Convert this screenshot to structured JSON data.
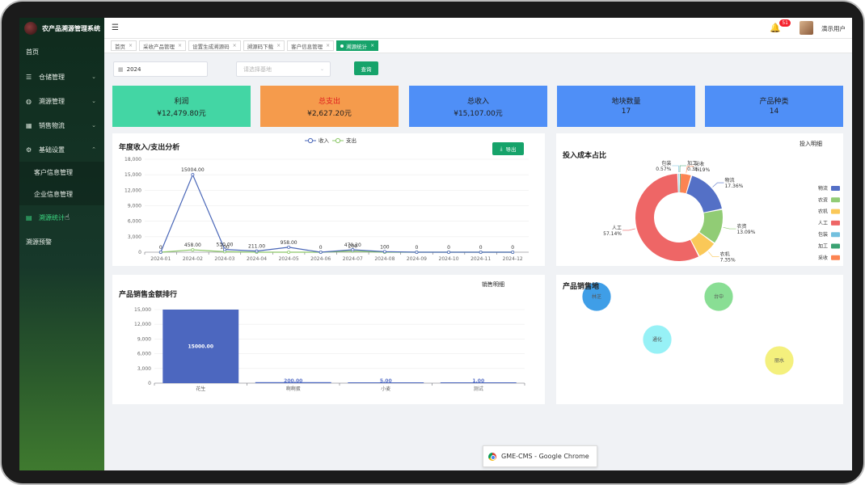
{
  "app": {
    "title": "农产品溯源管理系统"
  },
  "sidebar": {
    "items": [
      {
        "label": "首页"
      },
      {
        "label": "仓储管理",
        "icon": "list-icon"
      },
      {
        "label": "溯源管理",
        "icon": "globe-icon"
      },
      {
        "label": "销售物流",
        "icon": "cart-icon"
      },
      {
        "label": "基础设置",
        "icon": "gear-icon"
      },
      {
        "label": "客户信息管理"
      },
      {
        "label": "企业信息管理"
      },
      {
        "label": "溯源统计",
        "icon": "report-icon"
      },
      {
        "label": "溯源预警"
      }
    ]
  },
  "topbar": {
    "notification_count": "51",
    "username": "演示用户"
  },
  "tabs": [
    {
      "label": "首页"
    },
    {
      "label": "采收产品管理"
    },
    {
      "label": "设置生成溯源码"
    },
    {
      "label": "溯源码下载"
    },
    {
      "label": "客户信息管理"
    },
    {
      "label": "溯源统计"
    }
  ],
  "filters": {
    "year": "2024",
    "base_placeholder": "请选择基地",
    "query_label": "查询"
  },
  "stats": [
    {
      "label": "利润",
      "value": "¥12,479.80元",
      "color": "#43d6a4",
      "label_color": "#1f1f1f"
    },
    {
      "label": "总支出",
      "value": "¥2,627.20元",
      "color": "#f59b4c",
      "label_color": "#e01e1e"
    },
    {
      "label": "总收入",
      "value": "¥15,107.00元",
      "color": "#4f8ff7",
      "label_color": "#1f1f1f"
    },
    {
      "label": "地块数量",
      "value": "17",
      "color": "#4f8ff7",
      "label_color": "#1f1f1f"
    },
    {
      "label": "产品种类",
      "value": "14",
      "color": "#4f8ff7",
      "label_color": "#1f1f1f"
    }
  ],
  "income_chart": {
    "title": "年度收入/支出分析",
    "export_label": "导出",
    "legend": [
      "收入",
      "支出"
    ],
    "chart_data": {
      "type": "line",
      "categories": [
        "2024-01",
        "2024-02",
        "2024-03",
        "2024-04",
        "2024-05",
        "2024-06",
        "2024-07",
        "2024-08",
        "2024-09",
        "2024-10",
        "2024-11",
        "2024-12"
      ],
      "series": [
        {
          "name": "收入",
          "values": [
            0,
            15004,
            530,
            211,
            958,
            0,
            470,
            100,
            0,
            0,
            0,
            0
          ],
          "color": "#4a67b8",
          "labels": [
            "0",
            "15004.00",
            "530.00",
            "211.00",
            "958.00",
            "0",
            "470.20",
            "100",
            "0",
            "0",
            "0",
            "0"
          ]
        },
        {
          "name": "支出",
          "values": [
            0,
            458,
            100,
            0,
            0,
            0,
            200,
            0,
            0,
            0,
            0,
            0
          ],
          "color": "#8cc868",
          "labels": [
            "",
            "458.00",
            "100",
            "",
            "",
            "",
            "200",
            "",
            "",
            "",
            "",
            ""
          ]
        }
      ],
      "yticks": [
        "0",
        "3,000",
        "6,000",
        "9,000",
        "12,000",
        "15,000",
        "18,000"
      ],
      "ylim": [
        0,
        18000
      ]
    }
  },
  "cost_chart": {
    "title": "投入成本占比",
    "detail_label": "投入明细",
    "chart_data": {
      "type": "pie",
      "slices": [
        {
          "name": "物流",
          "value": 17.36,
          "label": "17.36%",
          "color": "#5470c6"
        },
        {
          "name": "农资",
          "value": 13.09,
          "label": "13.09%",
          "color": "#91cc75"
        },
        {
          "name": "农机",
          "value": 7.35,
          "label": "7.35%",
          "color": "#fac858"
        },
        {
          "name": "人工",
          "value": 57.14,
          "label": "57.14%",
          "color": "#ee6666"
        },
        {
          "name": "包装",
          "value": 0.57,
          "label": "0.57%",
          "color": "#73c0de"
        },
        {
          "name": "加工",
          "value": 0.3,
          "label": "0.3%",
          "color": "#3ba272"
        },
        {
          "name": "采收",
          "value": 4.19,
          "label": "4.19%",
          "color": "#fc8452"
        }
      ]
    }
  },
  "sales_chart": {
    "title": "产品销售金额排行",
    "detail_label": "销售明细",
    "chart_data": {
      "type": "bar",
      "categories": [
        "花生",
        "啊啊蛋",
        "小麦",
        "测试"
      ],
      "values": [
        15000,
        200,
        5,
        1
      ],
      "labels": [
        "15000.00",
        "200.00",
        "5.00",
        "1.00"
      ],
      "yticks": [
        "0",
        "3,000",
        "6,000",
        "9,000",
        "12,000",
        "15,000"
      ],
      "ylim": [
        0,
        15000
      ],
      "color": "#4c67bf"
    }
  },
  "sales_region": {
    "title": "产品销售地",
    "bubbles": [
      {
        "name": "林芝",
        "color": "#2f96e6"
      },
      {
        "name": "台中",
        "color": "#7fdc8c"
      },
      {
        "name": "通化",
        "color": "#8ff0f6"
      },
      {
        "name": "丽水",
        "color": "#f4ef72"
      }
    ]
  },
  "chrome_tooltip": "GME-CMS - Google Chrome"
}
